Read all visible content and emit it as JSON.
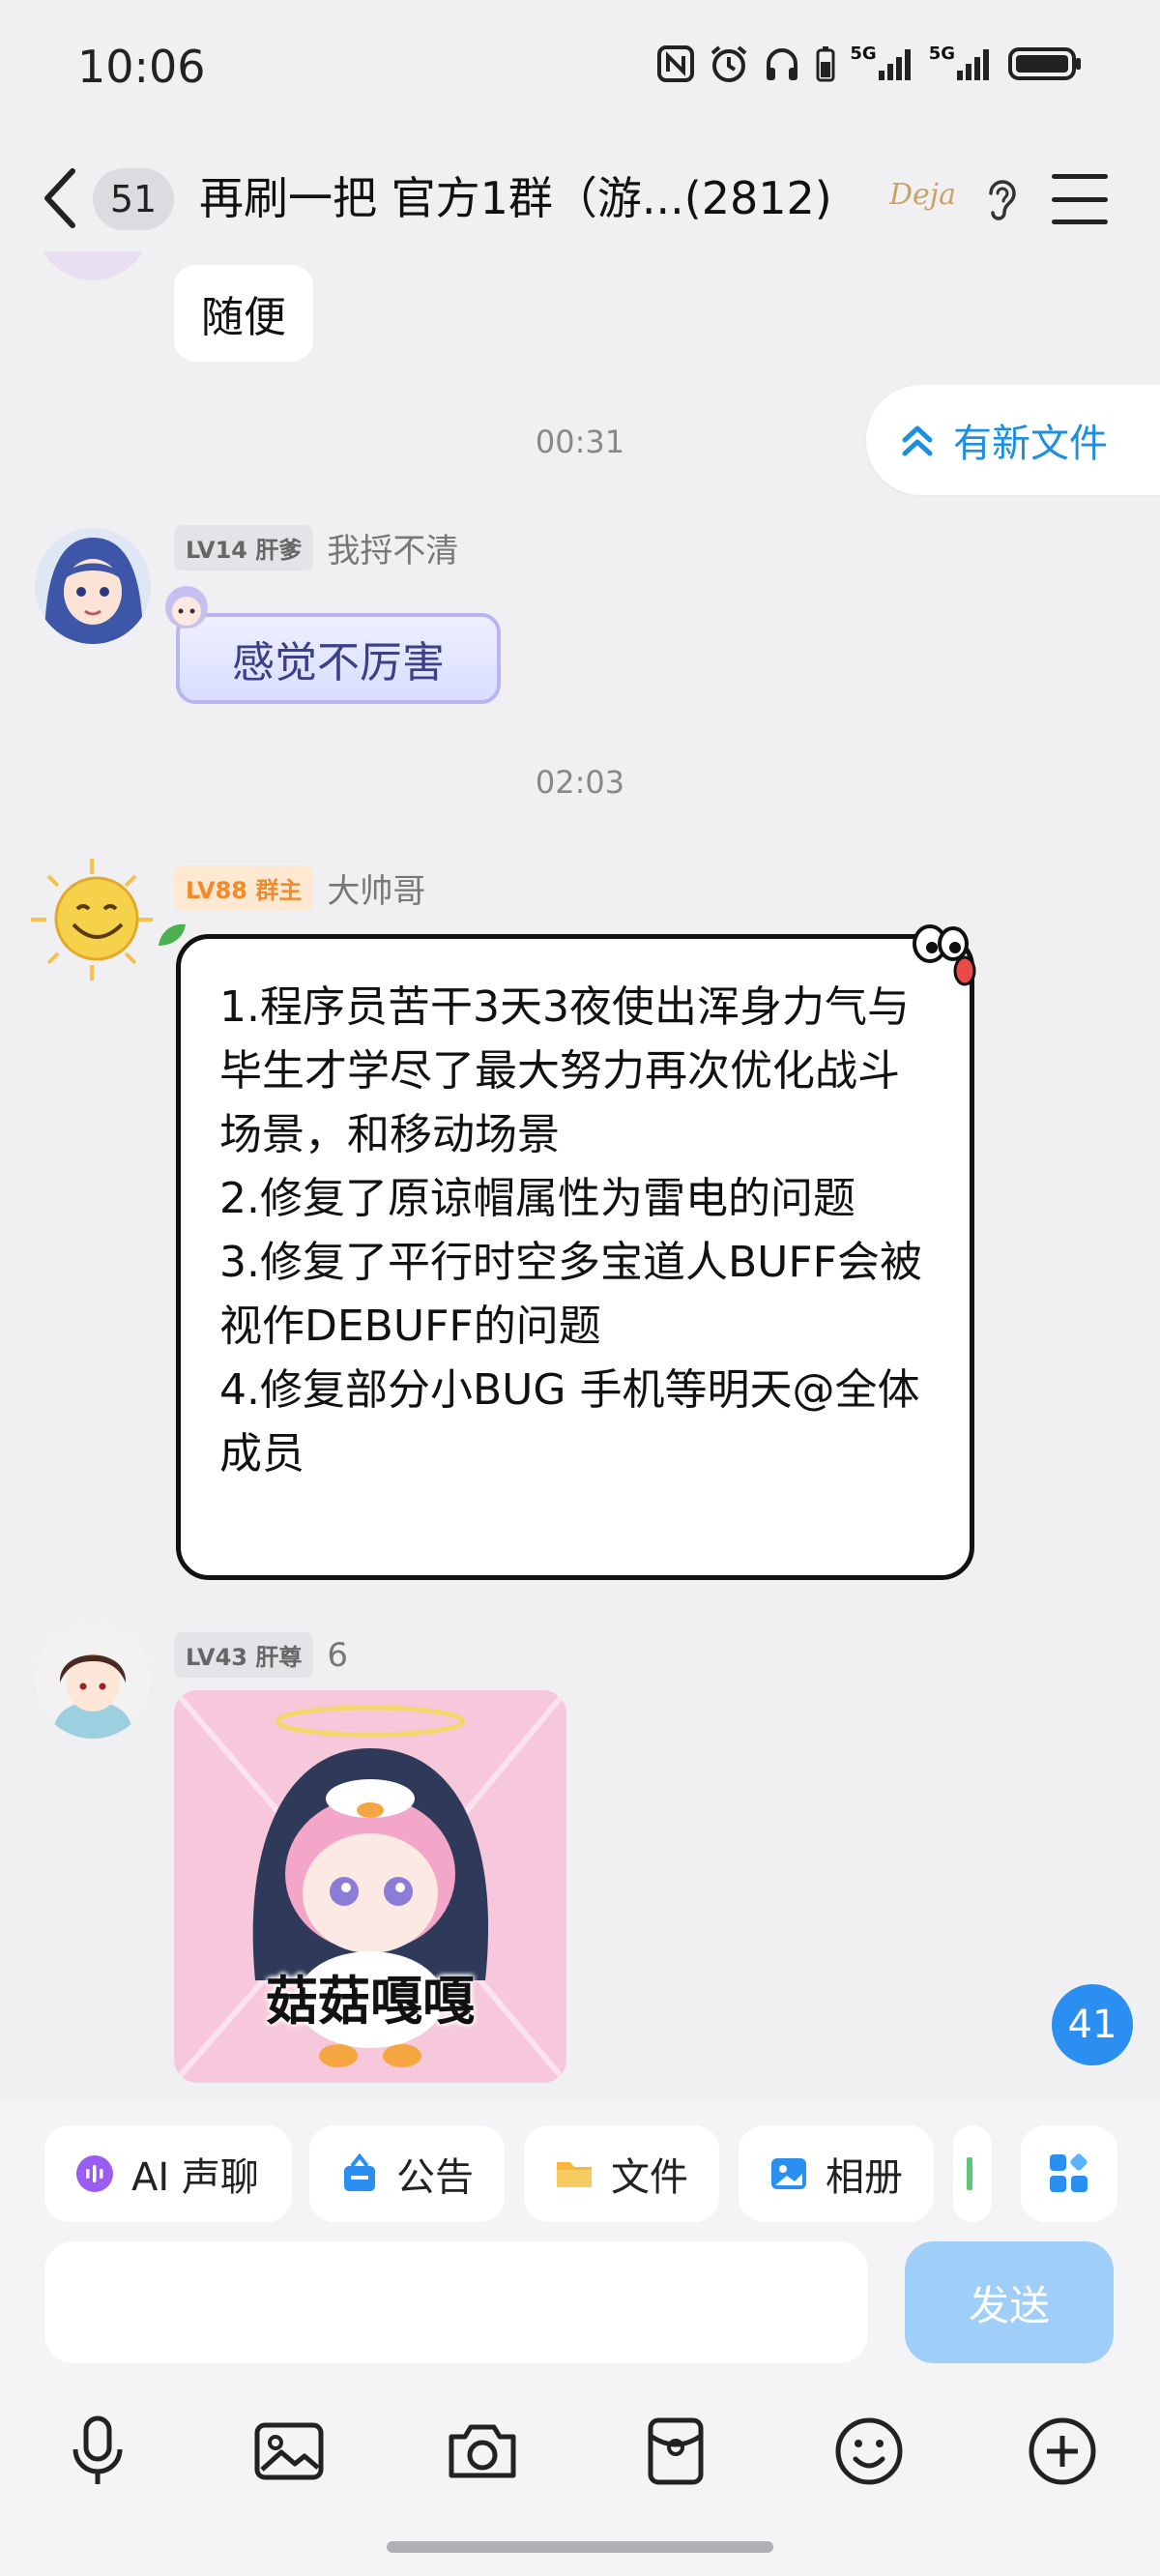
{
  "status_bar": {
    "time": "10:06",
    "network1": "5G",
    "network2": "5G",
    "icons": [
      "nfc-icon",
      "alarm-icon",
      "headphones-icon",
      "battery-saver-icon",
      "signal-icon",
      "signal-icon",
      "battery-icon"
    ]
  },
  "header": {
    "back_icon": "chevron-left-icon",
    "unread_count": "51",
    "title": "再刷一把 官方1群（游...(2812)",
    "logo_text": "Deja",
    "ear_icon": "ear-icon",
    "menu_icon": "hamburger-menu-icon"
  },
  "chat": {
    "prev_message": "随便",
    "new_file_pill": "有新文件",
    "time1": "00:31",
    "msg1": {
      "level": "LV14 肝爹",
      "name": "我捋不清",
      "text": "感觉不厉害"
    },
    "time2": "02:03",
    "msg2": {
      "level": "LV88 群主",
      "name": "大帅哥",
      "text": "1.程序员苦干3天3夜使出浑身力气与毕生才学尽了最大努力再次优化战斗场景，和移动场景\n2.修复了原谅帽属性为雷电的问题\n3.修复了平行时空多宝道人BUFF会被视作DEBUFF的问题\n4.修复部分小BUG 手机等明天@全体成员"
    },
    "msg3": {
      "level": "LV43 肝尊",
      "name": "6",
      "sticker_caption": "菇菇嘎嘎"
    },
    "floating_unread": "41"
  },
  "quick_actions": [
    {
      "label": "AI 声聊",
      "icon": "ai-voice-icon"
    },
    {
      "label": "公告",
      "icon": "announcement-icon"
    },
    {
      "label": "文件",
      "icon": "folder-icon"
    },
    {
      "label": "相册",
      "icon": "album-icon"
    }
  ],
  "composer": {
    "send_label": "发送"
  },
  "toolbar": [
    "microphone-icon",
    "image-icon",
    "camera-icon",
    "red-packet-icon",
    "emoji-icon",
    "plus-icon"
  ],
  "colors": {
    "accent": "#1e8ee0",
    "send_disabled": "#9fcff8",
    "badge_blue": "#2a8ff0",
    "owner_badge": "#f08a2a"
  }
}
